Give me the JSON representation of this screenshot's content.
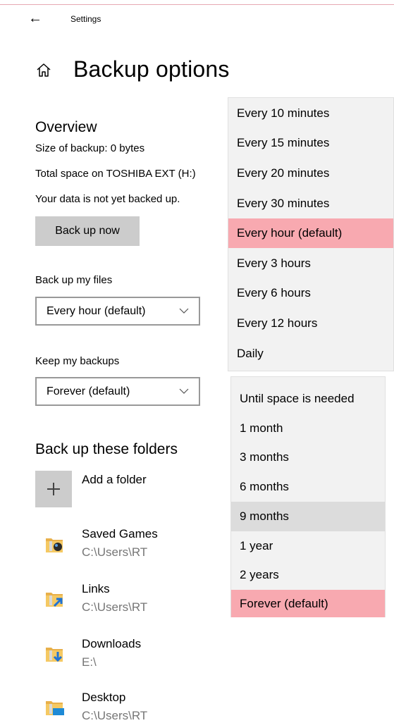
{
  "window": {
    "title": "Settings"
  },
  "page": {
    "title": "Backup options"
  },
  "overview": {
    "heading": "Overview",
    "size_line": "Size of backup: 0 bytes",
    "space_line": "Total space on TOSHIBA EXT (H:)",
    "status_line": "Your data is not yet backed up.",
    "backup_button": "Back up now"
  },
  "backup_files": {
    "label": "Back up my files",
    "value": "Every hour (default)"
  },
  "keep_backups": {
    "label": "Keep my backups",
    "value": "Forever (default)"
  },
  "folders": {
    "heading": "Back up these folders",
    "add_label": "Add a folder",
    "items": [
      {
        "name": "Saved Games",
        "path": "C:\\Users\\RT",
        "icon": "saved-games-folder-icon"
      },
      {
        "name": "Links",
        "path": "C:\\Users\\RT",
        "icon": "links-folder-icon"
      },
      {
        "name": "Downloads",
        "path": "E:\\",
        "icon": "downloads-folder-icon"
      },
      {
        "name": "Desktop",
        "path": "C:\\Users\\RT",
        "icon": "desktop-folder-icon"
      }
    ]
  },
  "frequency_menu": {
    "options": [
      "Every 10 minutes",
      "Every 15 minutes",
      "Every 20 minutes",
      "Every 30 minutes",
      "Every hour (default)",
      "Every 3 hours",
      "Every 6 hours",
      "Every 12 hours",
      "Daily"
    ],
    "selected": "Every hour (default)"
  },
  "retention_menu": {
    "options": [
      "Until space is needed",
      "1 month",
      "3 months",
      "6 months",
      "9 months",
      "1 year",
      "2 years",
      "Forever (default)"
    ],
    "selected": "Forever (default)",
    "hovered": "9 months"
  },
  "colors": {
    "selected": "#f8a9b0",
    "button": "#cccccc",
    "menu": "#f2f2f2",
    "hover": "#dcdcdc",
    "path_text": "#767676"
  }
}
